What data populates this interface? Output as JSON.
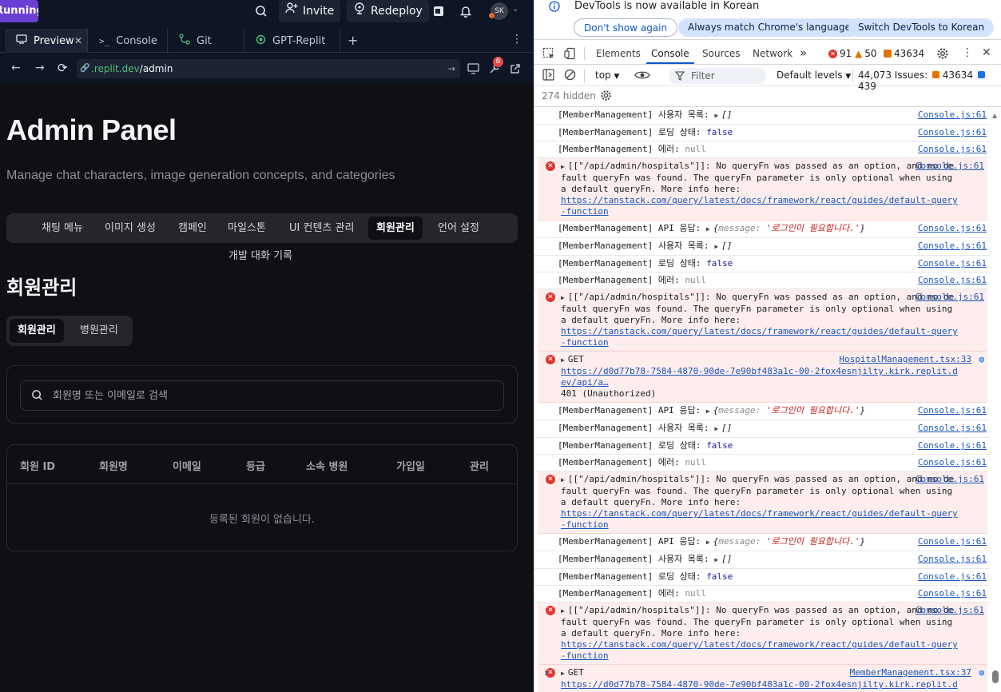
{
  "replit": {
    "running_label": "Running",
    "invite_label": "Invite",
    "redeploy_label": "Redeploy",
    "avatar_initials": "SK",
    "tabs": [
      {
        "label": "Preview"
      },
      {
        "label": "Console"
      },
      {
        "label": "Git"
      },
      {
        "label": "GPT-Replit"
      }
    ],
    "url_domain": ".replit.dev",
    "url_path": "/admin",
    "badge_count": "6"
  },
  "page": {
    "title": "Admin Panel",
    "subtitle": "Manage chat characters, image generation concepts, and categories",
    "nav_tabs": [
      "채팅 메뉴",
      "이미지 생성",
      "캠페인",
      "마일스톤",
      "UI 컨텐츠 관리",
      "회원관리",
      "언어 설정"
    ],
    "nav_tab_extra": "개발 대화 기록",
    "active_nav_tab": "회원관리",
    "section_title": "회원관리",
    "sub_tabs": [
      "회원관리",
      "병원관리"
    ],
    "search_placeholder": "회원명 또는 이메일로 검색",
    "table_headers": [
      "회원 ID",
      "회원명",
      "이메일",
      "등급",
      "소속 병원",
      "가입일",
      "관리"
    ],
    "table_empty": "등록된 회원이 없습니다."
  },
  "devtools": {
    "info_text": "DevTools is now available in Korean",
    "btn_dont_show": "Don't show again",
    "btn_match": "Always match Chrome's language",
    "btn_switch": "Switch DevTools to Korean",
    "tabs": [
      "Elements",
      "Console",
      "Sources",
      "Network"
    ],
    "error_count": "91",
    "warning_count": "50",
    "issue_count": "43634",
    "context": "top",
    "filter_placeholder": "Filter",
    "levels": "Default levels",
    "issues_label": "44,073 Issues:",
    "issues_warn": "43634",
    "issues_info": "439",
    "hidden": "274 hidden",
    "log_users": "[MemberManagement] 사용자 목록:",
    "log_users_val": "[]",
    "log_loading": "[MemberManagement] 로딩 상태:",
    "log_loading_val": "false",
    "log_error": "[MemberManagement] 에러:",
    "log_error_val": "null",
    "log_api": "[MemberManagement] API 응답:",
    "log_api_prop": "message:",
    "log_api_val": "'로그인이 필요합니다.'",
    "source_console": "Console.js:61",
    "error_queryfn": "[[\"/api/admin/hospitals\"]]: No queryFn was passed as an option, and no default queryFn was found. The queryFn parameter is only optional when using a default queryFn. More info here:",
    "error_link": "https://tanstack.com/query/latest/docs/framework/react/guides/default-query-function",
    "get_label": "GET",
    "get_url": "https://d0d77b78-7584-4870-90de-7e90bf483a1c-00-2fox4esnjilty.kirk.replit.dev/api/a…",
    "get_status": "401 (Unauthorized)",
    "source_hospital": "HospitalManagement.tsx:33",
    "source_member": "MemberManagement.tsx:37",
    "prompt": "›"
  }
}
